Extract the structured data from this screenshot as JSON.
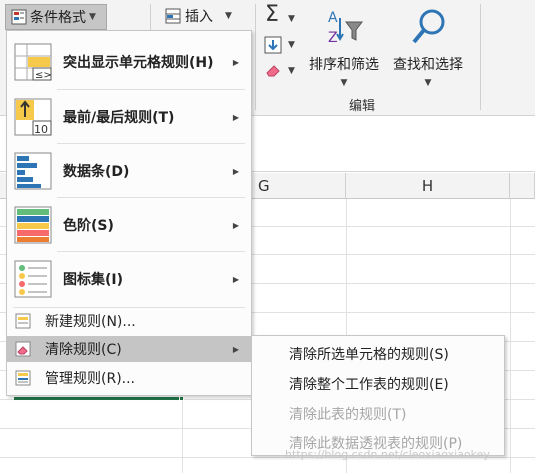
{
  "ribbon": {
    "cf_label": "条件格式",
    "insert_label": "插入",
    "sort_filter_label": "排序和筛选",
    "find_select_label": "查找和选择",
    "group_label": "编辑"
  },
  "grid": {
    "col_g": "G",
    "col_h": "H"
  },
  "menu": {
    "items": [
      {
        "label": "突出显示单元格规则(H)",
        "icon": "highlight-cells-icon"
      },
      {
        "label": "最前/最后规则(T)",
        "icon": "top-bottom-icon"
      },
      {
        "label": "数据条(D)",
        "icon": "data-bars-icon"
      },
      {
        "label": "色阶(S)",
        "icon": "color-scales-icon"
      },
      {
        "label": "图标集(I)",
        "icon": "icon-sets-icon"
      }
    ],
    "new_rule": "新建规则(N)...",
    "clear_rules": "清除规则(C)",
    "manage_rules": "管理规则(R)..."
  },
  "submenu": {
    "items": [
      {
        "label": "清除所选单元格的规则(S)",
        "enabled": true
      },
      {
        "label": "清除整个工作表的规则(E)",
        "enabled": true
      },
      {
        "label": "清除此表的规则(T)",
        "enabled": false
      },
      {
        "label": "清除此数据透视表的规则(P)",
        "enabled": false
      }
    ]
  },
  "watermark": "https://blog.csdn.net/cleoxiaoxiaokey",
  "colors": {
    "accent": "#217346",
    "highlight": "#c5c5c5",
    "disabled": "#a6a6a6"
  }
}
